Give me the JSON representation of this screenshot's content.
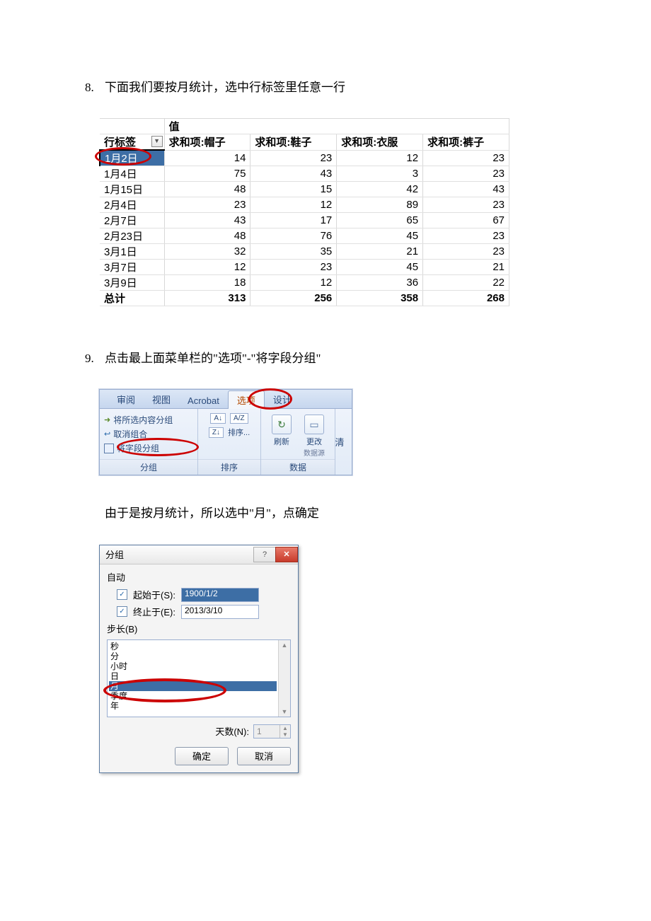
{
  "step8": {
    "num": "8.",
    "text": "下面我们要按月统计，选中行标签里任意一行",
    "pivot": {
      "value_header": "值",
      "row_label": "行标签",
      "cols": [
        "求和项:帽子",
        "求和项:鞋子",
        "求和项:衣服",
        "求和项:裤子"
      ],
      "rows": [
        {
          "label": "1月2日",
          "v": [
            14,
            23,
            12,
            23
          ],
          "selected": true
        },
        {
          "label": "1月4日",
          "v": [
            75,
            43,
            3,
            23
          ]
        },
        {
          "label": "1月15日",
          "v": [
            48,
            15,
            42,
            43
          ]
        },
        {
          "label": "2月4日",
          "v": [
            23,
            12,
            89,
            23
          ]
        },
        {
          "label": "2月7日",
          "v": [
            43,
            17,
            65,
            67
          ]
        },
        {
          "label": "2月23日",
          "v": [
            48,
            76,
            45,
            23
          ]
        },
        {
          "label": "3月1日",
          "v": [
            32,
            35,
            21,
            23
          ]
        },
        {
          "label": "3月7日",
          "v": [
            12,
            23,
            45,
            21
          ]
        },
        {
          "label": "3月9日",
          "v": [
            18,
            12,
            36,
            22
          ]
        }
      ],
      "total_label": "总计",
      "totals": [
        313,
        256,
        358,
        268
      ]
    }
  },
  "step9": {
    "num": "9.",
    "text": "点击最上面菜单栏的\"选项\"-\"将字段分组\"",
    "ribbon": {
      "tabs": [
        "审阅",
        "视图",
        "Acrobat",
        "选项",
        "设计"
      ],
      "active_tab_index": 3,
      "group_group": {
        "label": "分组",
        "items": [
          "将所选内容分组",
          "取消组合",
          "将字段分组"
        ]
      },
      "sort_group": {
        "label": "排序",
        "az": "A↓Z",
        "za": "Z↓A",
        "btn": "排序...",
        "small1": "A/Z",
        "small2": "Z/A"
      },
      "data_group": {
        "label": "数据",
        "refresh": "刷新",
        "change": "更改",
        "change_sub": "数据源"
      }
    },
    "note": "由于是按月统计，所以选中\"月\"，点确定"
  },
  "dialog": {
    "title": "分组",
    "auto": "自动",
    "start_label": "起始于(S):",
    "start_value": "1900/1/2",
    "end_label": "终止于(E):",
    "end_value": "2013/3/10",
    "step_label": "步长(B)",
    "options": [
      "秒",
      "分",
      "小时",
      "日",
      "月",
      "季度",
      "年"
    ],
    "selected_index": 4,
    "days_label": "天数(N):",
    "days_value": "1",
    "ok": "确定",
    "cancel": "取消"
  }
}
